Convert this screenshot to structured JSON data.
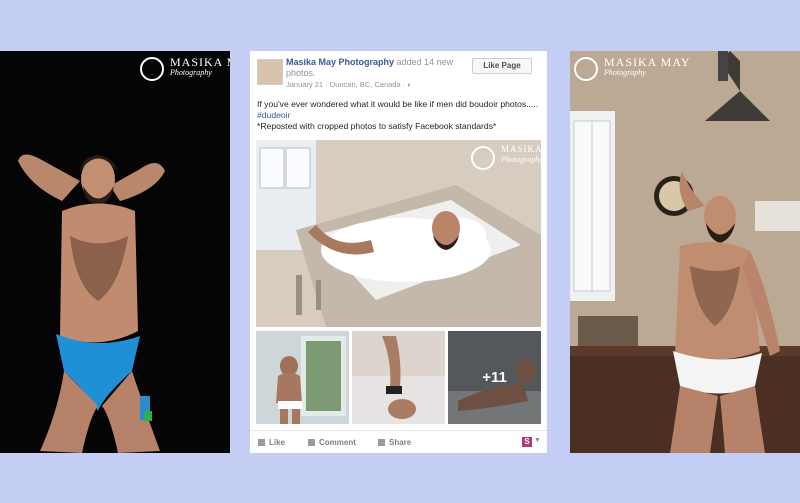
{
  "watermark": {
    "brand": "MASIKA MAY",
    "sub": "Photography"
  },
  "post": {
    "page_name": "Masika May Photography",
    "added_text": " added 14 new photos.",
    "meta": "January 21 · Duncan, BC, Canada · ◐",
    "like_page": "Like Page",
    "text_line1": "If you've ever wondered what it would be like if men did boudoir photos..... ",
    "hashtag": "#dudeoir",
    "text_line2": "*Reposted with cropped photos to satisfy Facebook standards*",
    "more_photos": "+11",
    "actions": {
      "like": "Like",
      "comment": "Comment",
      "share": "Share"
    },
    "share_badge": "S"
  },
  "icons": [
    "like-icon",
    "comment-icon",
    "share-icon",
    "camera-logo-icon",
    "caret-down-icon"
  ],
  "colors": {
    "background": "#c4cdf3",
    "facebook_blue": "#3b5998",
    "underwear_blue": "#1f8fd6"
  }
}
